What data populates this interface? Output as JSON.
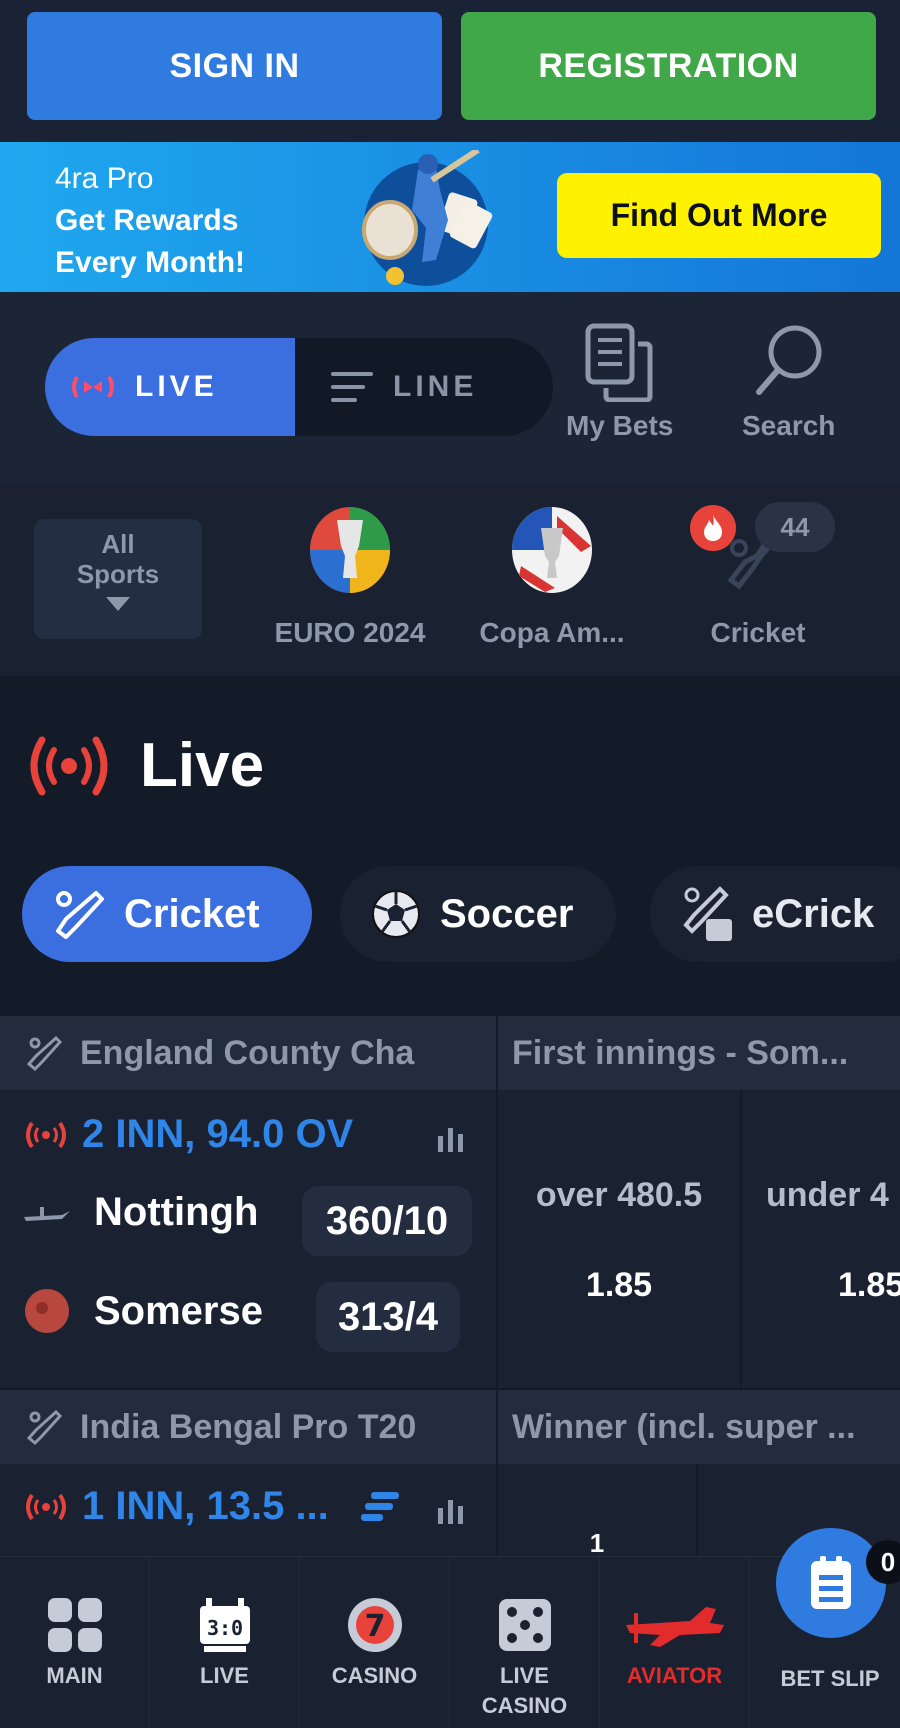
{
  "auth": {
    "sign_in": "SIGN IN",
    "registration": "REGISTRATION"
  },
  "promo": {
    "line1": "4ra Pro",
    "line2": "Get Rewards",
    "line3": "Every Month!",
    "cta": "Find Out More"
  },
  "modes": {
    "live": "LIVE",
    "line": "LINE"
  },
  "actions": {
    "my_bets": "My Bets",
    "search": "Search"
  },
  "sports_strip": {
    "all_sports_line1": "All",
    "all_sports_line2": "Sports",
    "items": [
      {
        "label": "EURO 2024",
        "icon": "euro-2024-emblem"
      },
      {
        "label": "Copa Am...",
        "icon": "copa-america-emblem"
      },
      {
        "label": "Cricket",
        "icon": "cricket-icon",
        "count": "44"
      }
    ]
  },
  "live_section": {
    "title": "Live",
    "chips": [
      {
        "label": "Cricket",
        "icon": "cricket-bat-icon"
      },
      {
        "label": "Soccer",
        "icon": "soccer-ball-icon"
      },
      {
        "label": "eCrick",
        "icon": "ecricket-icon"
      }
    ]
  },
  "matches": [
    {
      "league": "England County Cha",
      "market": "First innings - Som...",
      "status": "2 INN, 94.0 OV",
      "teams": [
        {
          "name": "Nottingh",
          "score": "360/10"
        },
        {
          "name": "Somerse",
          "score": "313/4"
        }
      ],
      "odds": [
        {
          "label": "over 480.5",
          "value": "1.85"
        },
        {
          "label": "under 4",
          "value": "1.85"
        }
      ]
    },
    {
      "league": "India Bengal Pro T20",
      "market": "Winner (incl. super ...",
      "status": "1 INN, 13.5 ...",
      "odds_partial": "1"
    }
  ],
  "bottom_nav": {
    "main": "MAIN",
    "live": "LIVE",
    "casino": "CASINO",
    "live_casino_1": "LIVE",
    "live_casino_2": "CASINO",
    "aviator": "AVIATOR",
    "bet_slip": "BET SLIP",
    "bet_slip_count": "0"
  },
  "colors": {
    "accent_blue": "#2f7be0",
    "accent_green": "#41a84a",
    "cta_yellow": "#fff200",
    "live_red": "#e8433a",
    "status_blue": "#2f86e8"
  }
}
